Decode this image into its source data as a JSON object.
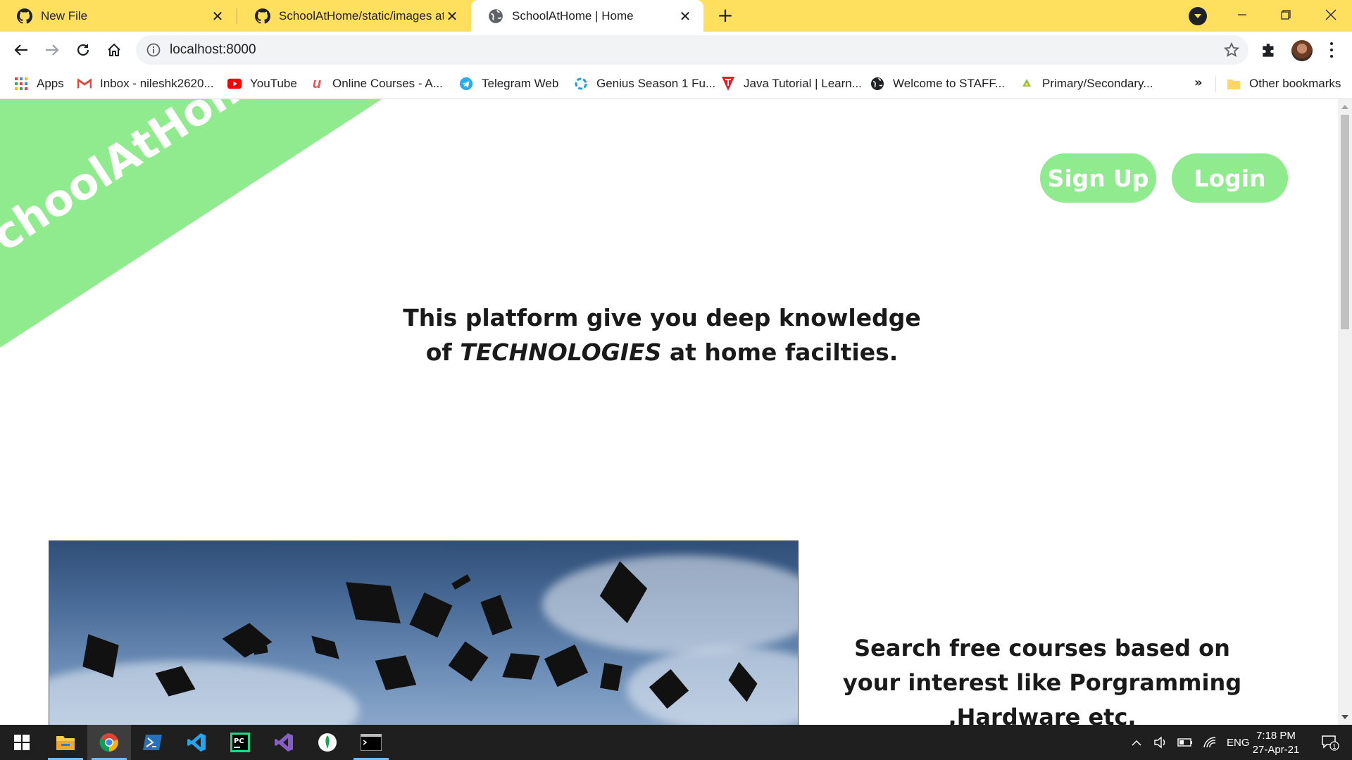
{
  "browser": {
    "tabs": [
      {
        "title": "New File",
        "icon": "github-icon"
      },
      {
        "title": "SchoolAtHome/static/images at m",
        "icon": "github-icon"
      },
      {
        "title": "SchoolAtHome | Home",
        "icon": "globe-icon",
        "active": true
      }
    ],
    "address": "localhost:8000",
    "bookmarks": [
      {
        "label": "Apps",
        "icon": "apps-grid-icon"
      },
      {
        "label": "Inbox - nileshk2620...",
        "icon": "gmail-icon"
      },
      {
        "label": "YouTube",
        "icon": "youtube-icon"
      },
      {
        "label": "Online Courses - A...",
        "icon": "udemy-icon"
      },
      {
        "label": "Telegram Web",
        "icon": "telegram-icon"
      },
      {
        "label": "Genius Season 1 Fu...",
        "icon": "genius-icon"
      },
      {
        "label": "Java Tutorial | Learn...",
        "icon": "tutorialspoint-icon"
      },
      {
        "label": "Welcome to STAFF...",
        "icon": "globe-icon"
      },
      {
        "label": "Primary/Secondary...",
        "icon": "recycle-icon"
      }
    ],
    "bookmarks_more": "»",
    "other_bookmarks": "Other bookmarks",
    "accent_color": "#ffdf5d"
  },
  "page": {
    "logo": "SchoolAtHome",
    "signup_label": "Sign Up",
    "login_label": "Login",
    "tagline_line1": "This platform give you deep knowledge",
    "tagline_of": "of",
    "tagline_em": "TECHNOLOGIES",
    "tagline_rest": "at home facilties.",
    "side_line1": "Search free courses based on",
    "side_line2": "your interest like Porgramming",
    "side_line3": ",Hardware etc.",
    "brand_color": "#90ea8e"
  },
  "taskbar": {
    "apps": [
      "start-icon",
      "file-explorer-icon",
      "chrome-icon",
      "powershell-icon",
      "vscode-icon",
      "pycharm-icon",
      "visual-studio-icon",
      "mongodb-compass-icon",
      "terminal-icon"
    ],
    "language": "ENG",
    "time": "7:18 PM",
    "date": "27-Apr-21",
    "notifications": "1"
  }
}
